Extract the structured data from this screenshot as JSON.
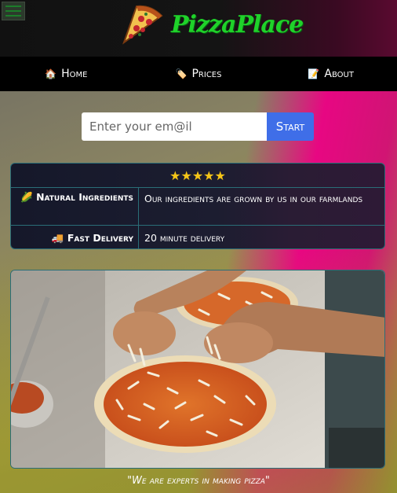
{
  "header": {
    "brand": "PizzaPlace",
    "menu_icon": "hamburger-menu-icon",
    "logo_icon": "pizza-slice-icon"
  },
  "nav": {
    "items": [
      {
        "label": "Home",
        "icon": "🏠"
      },
      {
        "label": "Prices",
        "icon": "🏷️"
      },
      {
        "label": "About",
        "icon": "📝"
      }
    ]
  },
  "signup": {
    "placeholder": "Enter your em@il",
    "button_label": "Start"
  },
  "features": {
    "stars": "★★★★★",
    "rows": [
      {
        "icon": "🌽",
        "title": "Natural Ingredients",
        "text": "Our ingredients are grown by us in our farmlands"
      },
      {
        "icon": "🚚",
        "title": "Fast Delivery",
        "text": "20 minute delivery"
      }
    ]
  },
  "hero": {
    "caption": "\"We are experts in making pizza\""
  },
  "colors": {
    "brand_green": "#1fd22a",
    "button_blue": "#3f6ee8",
    "star_gold": "#f5c518",
    "accent_pink": "#ec0084"
  }
}
